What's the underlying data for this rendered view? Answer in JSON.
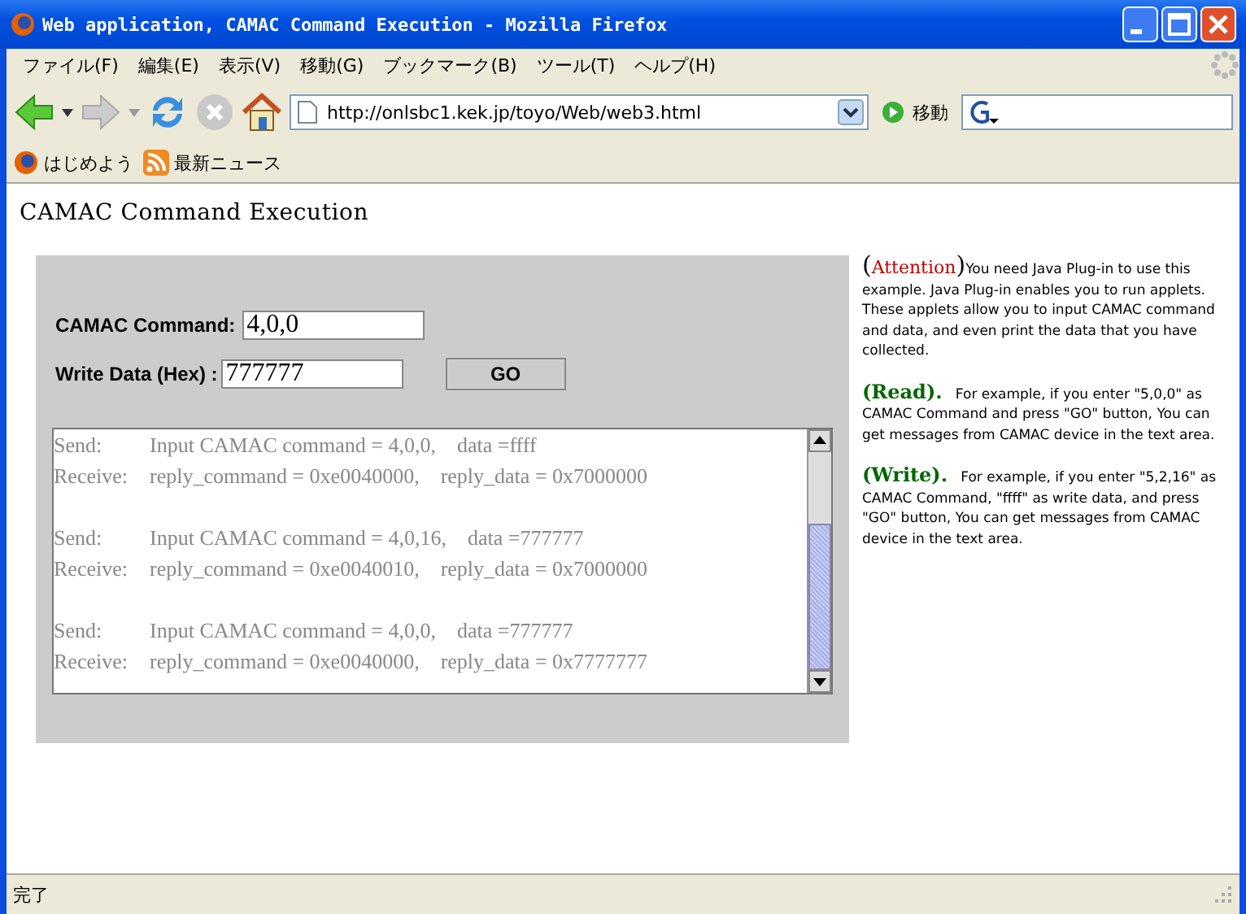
{
  "window": {
    "title": "Web application, CAMAC Command Execution - Mozilla Firefox"
  },
  "menu": [
    "ファイル(F)",
    "編集(E)",
    "表示(V)",
    "移動(G)",
    "ブックマーク(B)",
    "ツール(T)",
    "ヘルプ(H)"
  ],
  "toolbar": {
    "url": "http://onlsbc1.kek.jp/toyo/Web/web3.html",
    "go_label": "移動"
  },
  "bookmarks": [
    "はじめよう",
    "最新ニュース"
  ],
  "page": {
    "heading": "CAMAC Command Execution",
    "form": {
      "command_label": "CAMAC Command:",
      "command_value": "4,0,0",
      "data_label": "Write Data (Hex) :",
      "data_value": "777777",
      "button": "GO"
    },
    "log": [
      [
        {
          "label": "Send:",
          "message": "Input CAMAC command = 4,0,0,    data =ffff"
        },
        {
          "label": "Receive:",
          "message": "reply_command = 0xe0040000,    reply_data = 0x7000000"
        }
      ],
      [
        {
          "label": "Send:",
          "message": "Input CAMAC command = 4,0,16,    data =777777"
        },
        {
          "label": "Receive:",
          "message": "reply_command = 0xe0040010,    reply_data = 0x7000000"
        }
      ],
      [
        {
          "label": "Send:",
          "message": "Input CAMAC command = 4,0,0,    data =777777"
        },
        {
          "label": "Receive:",
          "message": "reply_command = 0xe0040000,    reply_data = 0x7777777"
        }
      ]
    ],
    "notes": [
      {
        "kind": "attention",
        "open": "(",
        "heading": "Attention",
        "close": ")",
        "color": "#c00000",
        "text": "You need Java Plug-in to use this example. Java Plug-in enables you to run applets. These applets allow you to input CAMAC command and data, and even print the data that you have collected."
      },
      {
        "kind": "section",
        "heading": "(Read).",
        "color": "#006600",
        "text": "For example, if you enter \"5,0,0\" as CAMAC Command and press \"GO\" button, You can get messages from CAMAC device in the text area."
      },
      {
        "kind": "section",
        "heading": "(Write).",
        "color": "#006600",
        "text": "For example, if you enter \"5,2,16\" as CAMAC Command, \"ffff\" as write data, and press \"GO\" button, You can get messages from CAMAC device in the text area."
      }
    ]
  },
  "status_bar": "完了"
}
